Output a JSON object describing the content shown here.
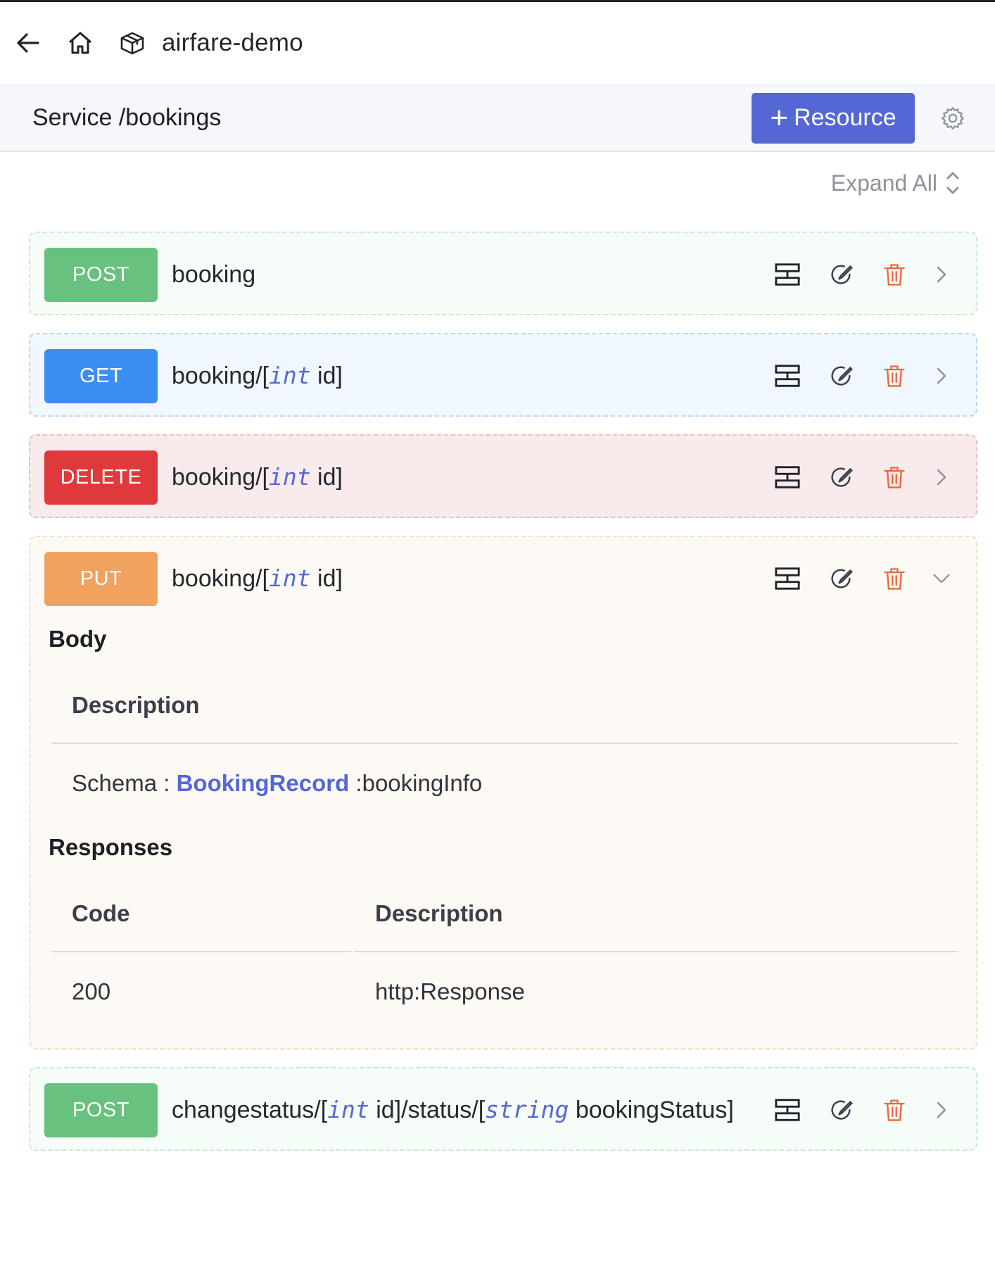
{
  "topbar": {
    "project_name": "airfare-demo",
    "icons": [
      "back-arrow-icon",
      "home-icon",
      "package-icon"
    ]
  },
  "service": {
    "title": "Service /bookings",
    "add_resource_label": "Resource",
    "add_resource_plus": "+"
  },
  "expand_all_label": "Expand All",
  "colors": {
    "post": "#68c17f",
    "get": "#3c8ff2",
    "delete": "#e0393c",
    "put": "#f2a25f",
    "accent": "#5567d5",
    "delete_icon": "#f0643f"
  },
  "resources": [
    {
      "method": "POST",
      "path_prefix": "booking",
      "expanded": false
    },
    {
      "method": "GET",
      "path_prefix": "booking/[",
      "type": "int",
      "path_suffix": " id]",
      "expanded": false
    },
    {
      "method": "DELETE",
      "path_prefix": "booking/[",
      "type": "int",
      "path_suffix": " id]",
      "expanded": false
    },
    {
      "method": "PUT",
      "path_prefix": "booking/[",
      "type": "int",
      "path_suffix": " id]",
      "expanded": true
    },
    {
      "method": "POST",
      "path_prefix": "changestatus/[",
      "type": "int",
      "path_mid": " id]/status/[",
      "type2": "string",
      "path_suffix": " bookingStatus]",
      "expanded": false
    }
  ],
  "put_details": {
    "body_title": "Body",
    "body_column": "Description",
    "schema_label": "Schema : ",
    "schema_type": "BookingRecord",
    "schema_name": " :bookingInfo",
    "responses_title": "Responses",
    "code_column": "Code",
    "description_column": "Description",
    "rows": [
      {
        "code": "200",
        "description": "http:Response"
      }
    ]
  }
}
